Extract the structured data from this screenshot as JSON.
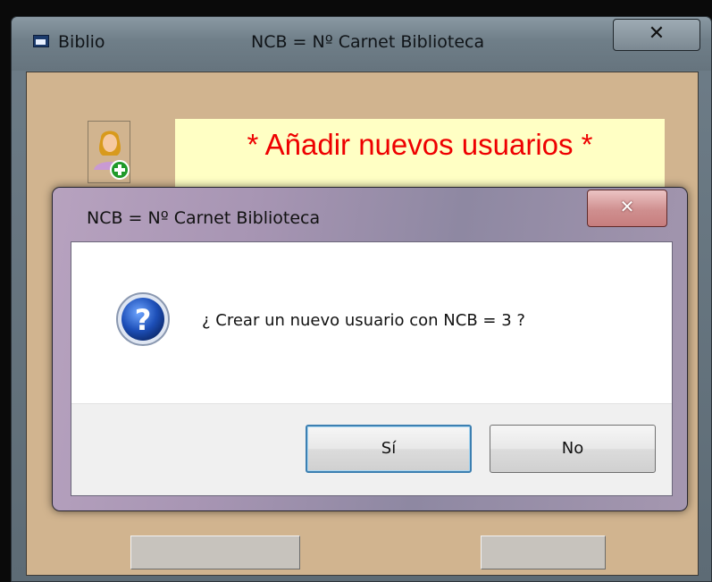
{
  "main_window": {
    "title": "Biblio",
    "title_center": "NCB = Nº Carnet Biblioteca",
    "close_glyph": "✕",
    "icon": "app-window-icon",
    "heading": "* Añadir nuevos usuarios *",
    "heading_color": "#ee0000",
    "background_color": "#d1b48f",
    "user_add_icon": "user-add-icon"
  },
  "dialog": {
    "title": "NCB = Nº Carnet Biblioteca",
    "close_glyph": "✕",
    "icon": "question-icon",
    "message": "¿ Crear un nuevo usuario con NCB = 3 ?",
    "yes_label": "Sí",
    "no_label": "No"
  }
}
